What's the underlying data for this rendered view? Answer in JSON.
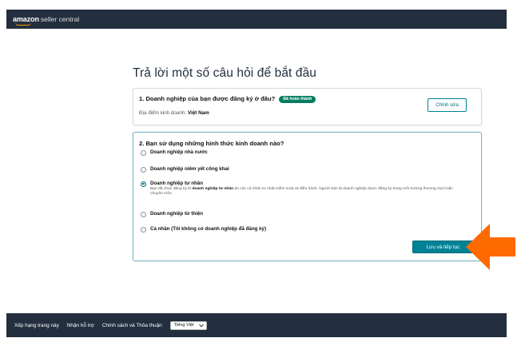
{
  "header": {
    "brand_amazon": "amazon",
    "brand_product": "seller central"
  },
  "page": {
    "title": "Trả lời một số câu hỏi để bắt đầu"
  },
  "question1": {
    "title": "1. Doanh nghiệp của bạn được đăng ký ở đâu?",
    "badge": "Đã hoàn thành",
    "location_label": "Địa điểm kinh doanh: ",
    "location_value": "Việt Nam",
    "edit_button": "Chỉnh sửa"
  },
  "question2": {
    "title": "2. Bạn sử dụng những hình thức kinh doanh nào?",
    "options": [
      {
        "label": "Doanh nghiệp nhà nước",
        "selected": false
      },
      {
        "label": "Doanh nghiệp niêm yết công khai",
        "selected": false
      },
      {
        "label": "Doanh nghiệp tư nhân",
        "selected": true,
        "desc_before": "Bạn đã chọn đăng ký là ",
        "desc_bold": "doanh nghiệp tư nhân",
        "desc_after": " do các cá nhân tư nhân kiểm soát và điều hành. Người bán là doanh nghiệp được đăng ký trong môi trường thương mại hoặc chuyên môn."
      },
      {
        "label": "Doanh nghiệp từ thiện",
        "selected": false
      },
      {
        "label": "Cá nhân (Tôi không có doanh nghiệp đã đăng ký)",
        "selected": false
      }
    ],
    "save_button": "Lưu và tiếp tục"
  },
  "footer": {
    "links": [
      "Xếp hạng trang này",
      "Nhận hỗ trợ",
      "Chính sách và Thỏa thuận"
    ],
    "language": "Tiếng Việt"
  },
  "colors": {
    "nav_bg": "#232f3e",
    "accent_teal": "#008296",
    "badge_green": "#067d62",
    "arrow_orange": "#ff6a00"
  },
  "icons": {
    "annotation_arrow": "left-pointing-arrow",
    "language_chevron": "chevron-down"
  }
}
